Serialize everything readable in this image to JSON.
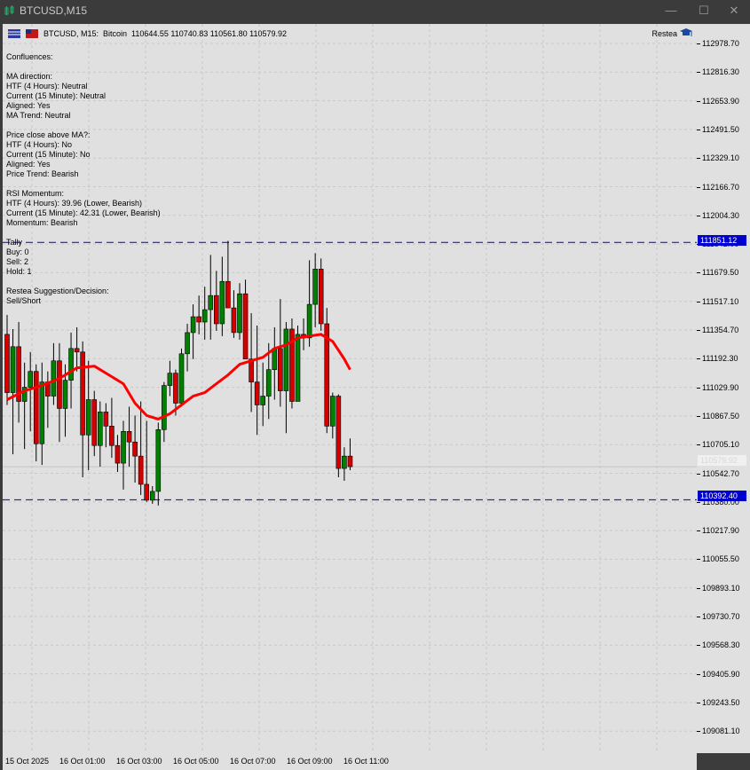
{
  "window": {
    "title": "BTCUSD,M15",
    "minimize_label": "—",
    "maximize_label": "☐",
    "close_label": "✕"
  },
  "header": {
    "symbol_line": "BTCUSD, M15:  Bitcoin  110644.55 110740.83 110561.80 110579.92",
    "brand": "Restea"
  },
  "info": {
    "lines": [
      "Confluences:",
      "",
      "MA direction:",
      "HTF (4 Hours): Neutral",
      "Current (15 Minute): Neutral",
      "Aligned: Yes",
      "MA Trend: Neutral",
      "",
      "Price close above MA?:",
      "HTF (4 Hours): No",
      "Current (15 Minute): No",
      "Aligned: Yes",
      "Price Trend: Bearish",
      "",
      "RSI Momentum:",
      "HTF (4 Hours): 39.96 (Lower, Bearish)",
      "Current (15 Minute): 42.31 (Lower, Bearish)",
      "Momentum: Bearish",
      "",
      "Tally",
      "Buy: 0",
      "Sell: 2",
      "Hold: 1",
      "",
      "Restea Suggestion/Decision:",
      "Sell/Short"
    ]
  },
  "price_scale": {
    "ticks": [
      "112978.70",
      "112816.30",
      "112653.90",
      "112491.50",
      "112329.10",
      "112166.70",
      "112004.30",
      "111842.00",
      "111679.50",
      "111517.10",
      "111354.70",
      "111192.30",
      "111029.90",
      "110867.50",
      "110705.10",
      "110542.70",
      "110380.00",
      "110217.90",
      "110055.50",
      "109893.10",
      "109730.70",
      "109568.30",
      "109405.90",
      "109243.50",
      "109081.10"
    ],
    "upper_level_label": "111851.12",
    "lower_level_label": "110392.40",
    "current_label": "110579.92"
  },
  "time_scale": {
    "labels": [
      "15 Oct 2025",
      "16 Oct 01:00",
      "16 Oct 03:00",
      "16 Oct 05:00",
      "16 Oct 07:00",
      "16 Oct 09:00",
      "16 Oct 11:00"
    ]
  },
  "colors": {
    "bull": "#008000",
    "bear": "#d40000",
    "ma": "#ff0000",
    "levels": "#0000cc",
    "grid": "#c8c8c8",
    "background": "#e0e0e0"
  },
  "chart_data": {
    "type": "candlestick",
    "levels": [
      111851.12,
      110392.4
    ],
    "candles": [
      [
        111330,
        111440,
        110930,
        111000
      ],
      [
        111000,
        111360,
        110650,
        111260
      ],
      [
        111260,
        111400,
        110830,
        110950
      ],
      [
        110950,
        111170,
        110680,
        111030
      ],
      [
        111030,
        111230,
        110780,
        111120
      ],
      [
        111120,
        111160,
        110610,
        110710
      ],
      [
        110710,
        111170,
        110590,
        111060
      ],
      [
        111060,
        111120,
        110800,
        110980
      ],
      [
        110980,
        111280,
        110930,
        111180
      ],
      [
        111180,
        111280,
        110720,
        110910
      ],
      [
        110910,
        111160,
        110750,
        111070
      ],
      [
        111070,
        111340,
        110910,
        111250
      ],
      [
        111250,
        111370,
        111120,
        111230
      ],
      [
        111230,
        111290,
        110520,
        110760
      ],
      [
        110760,
        111180,
        110560,
        110960
      ],
      [
        110960,
        111010,
        110640,
        110700
      ],
      [
        110700,
        110950,
        110580,
        110890
      ],
      [
        110890,
        110940,
        110690,
        110810
      ],
      [
        110810,
        110970,
        110630,
        110700
      ],
      [
        110700,
        110760,
        110550,
        110600
      ],
      [
        110600,
        110840,
        110450,
        110780
      ],
      [
        110780,
        110920,
        110580,
        110720
      ],
      [
        110720,
        110870,
        110490,
        110640
      ],
      [
        110640,
        110950,
        110420,
        110480
      ],
      [
        110480,
        110840,
        110380,
        110390
      ],
      [
        110390,
        110470,
        110370,
        110440
      ],
      [
        110440,
        110830,
        110360,
        110790
      ],
      [
        110790,
        111060,
        110720,
        111040
      ],
      [
        111040,
        111180,
        110980,
        111110
      ],
      [
        111110,
        111130,
        110870,
        110940
      ],
      [
        110940,
        111250,
        110920,
        111220
      ],
      [
        111220,
        111390,
        111120,
        111340
      ],
      [
        111340,
        111500,
        111190,
        111430
      ],
      [
        111430,
        111550,
        111330,
        111400
      ],
      [
        111400,
        111600,
        111300,
        111470
      ],
      [
        111470,
        111780,
        111300,
        111550
      ],
      [
        111550,
        111690,
        111350,
        111390
      ],
      [
        111390,
        111770,
        111320,
        111630
      ],
      [
        111630,
        111860,
        111560,
        111480
      ],
      [
        111480,
        111580,
        111310,
        111340
      ],
      [
        111340,
        111620,
        111300,
        111560
      ],
      [
        111560,
        111640,
        111230,
        111190
      ],
      [
        111190,
        111450,
        110890,
        111060
      ],
      [
        111060,
        111380,
        110760,
        110930
      ],
      [
        110930,
        111170,
        110810,
        110980
      ],
      [
        110980,
        111280,
        110850,
        111130
      ],
      [
        111130,
        111370,
        110960,
        111250
      ],
      [
        111250,
        111530,
        110920,
        111010
      ],
      [
        111010,
        111400,
        110770,
        111360
      ],
      [
        111360,
        111420,
        110910,
        110950
      ],
      [
        110950,
        111380,
        110950,
        111330
      ],
      [
        111330,
        111420,
        111240,
        111310
      ],
      [
        111310,
        111750,
        111260,
        111500
      ],
      [
        111500,
        111790,
        111370,
        111700
      ],
      [
        111700,
        111760,
        111350,
        111390
      ],
      [
        111390,
        111480,
        110770,
        110810
      ],
      [
        110810,
        111000,
        110740,
        110980
      ],
      [
        110980,
        110990,
        110520,
        110570
      ],
      [
        110570,
        110690,
        110500,
        110640
      ],
      [
        110640,
        110740,
        110560,
        110580
      ]
    ],
    "ma_path": [
      [
        0,
        110960
      ],
      [
        3,
        111010
      ],
      [
        6,
        111040
      ],
      [
        9,
        111080
      ],
      [
        12,
        111140
      ],
      [
        15,
        111150
      ],
      [
        18,
        111090
      ],
      [
        20,
        111050
      ],
      [
        22,
        110940
      ],
      [
        24,
        110870
      ],
      [
        26,
        110850
      ],
      [
        28,
        110880
      ],
      [
        30,
        110930
      ],
      [
        32,
        110980
      ],
      [
        34,
        111000
      ],
      [
        36,
        111050
      ],
      [
        38,
        111100
      ],
      [
        40,
        111160
      ],
      [
        42,
        111180
      ],
      [
        44,
        111200
      ],
      [
        46,
        111250
      ],
      [
        48,
        111270
      ],
      [
        50,
        111310
      ],
      [
        52,
        111320
      ],
      [
        54,
        111330
      ],
      [
        56,
        111290
      ],
      [
        58,
        111190
      ],
      [
        59,
        111130
      ]
    ]
  }
}
